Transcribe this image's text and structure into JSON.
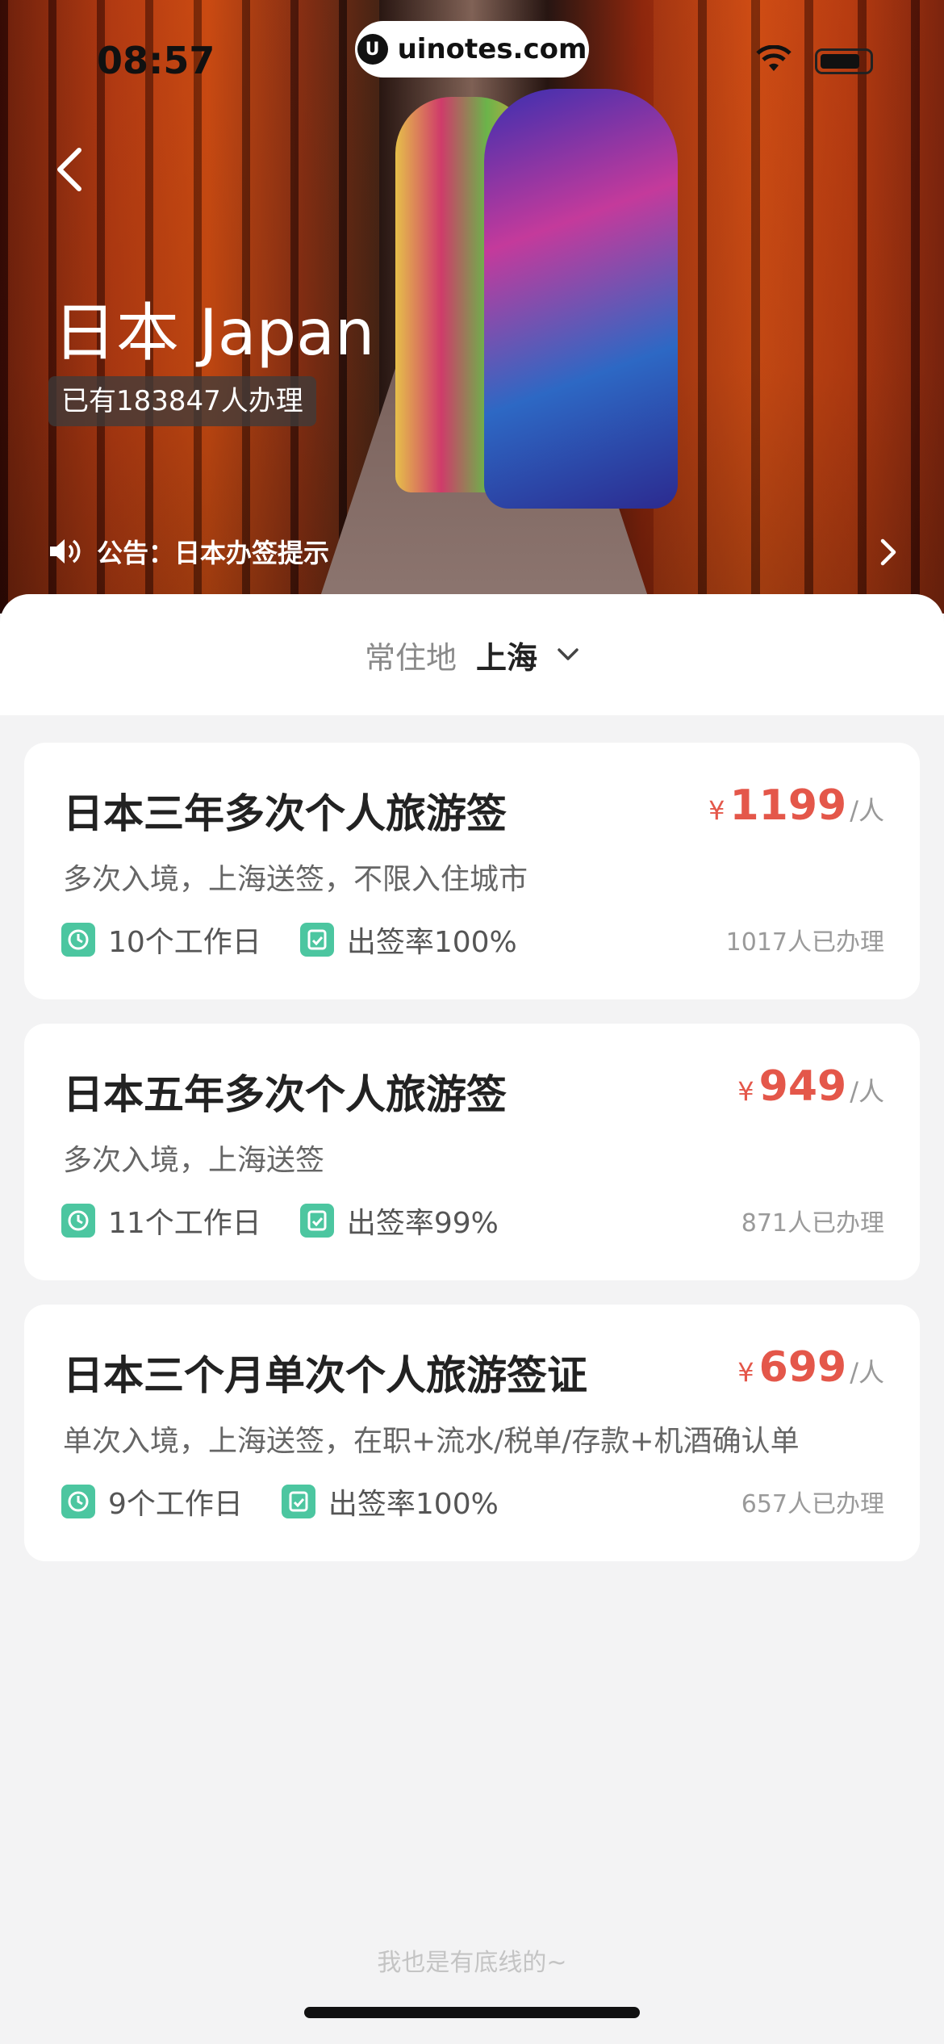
{
  "status_bar": {
    "time": "08:57",
    "url": "uinotes.com"
  },
  "hero": {
    "title": "日本 Japan",
    "processed_count": "已有183847人办理",
    "notice": "公告：日本办签提示"
  },
  "residence": {
    "label": "常住地",
    "value": "上海"
  },
  "products": [
    {
      "title": "日本三年多次个人旅游签",
      "currency": "¥",
      "price": "1199",
      "unit": "/人",
      "desc": "多次入境，上海送签，不限入住城市",
      "workdays": "10个工作日",
      "rate": "出签率100%",
      "applied": "1017人已办理"
    },
    {
      "title": "日本五年多次个人旅游签",
      "currency": "¥",
      "price": "949",
      "unit": "/人",
      "desc": "多次入境，上海送签",
      "workdays": "11个工作日",
      "rate": "出签率99%",
      "applied": "871人已办理"
    },
    {
      "title": "日本三个月单次个人旅游签证",
      "currency": "¥",
      "price": "699",
      "unit": "/人",
      "desc": "单次入境，上海送签，在职+流水/税单/存款+机酒确认单",
      "workdays": "9个工作日",
      "rate": "出签率100%",
      "applied": "657人已办理"
    }
  ],
  "footer": "我也是有底线的~",
  "colors": {
    "price": "#e4574a",
    "icon_green": "#4cc6a0",
    "background": "#f3f3f4"
  }
}
